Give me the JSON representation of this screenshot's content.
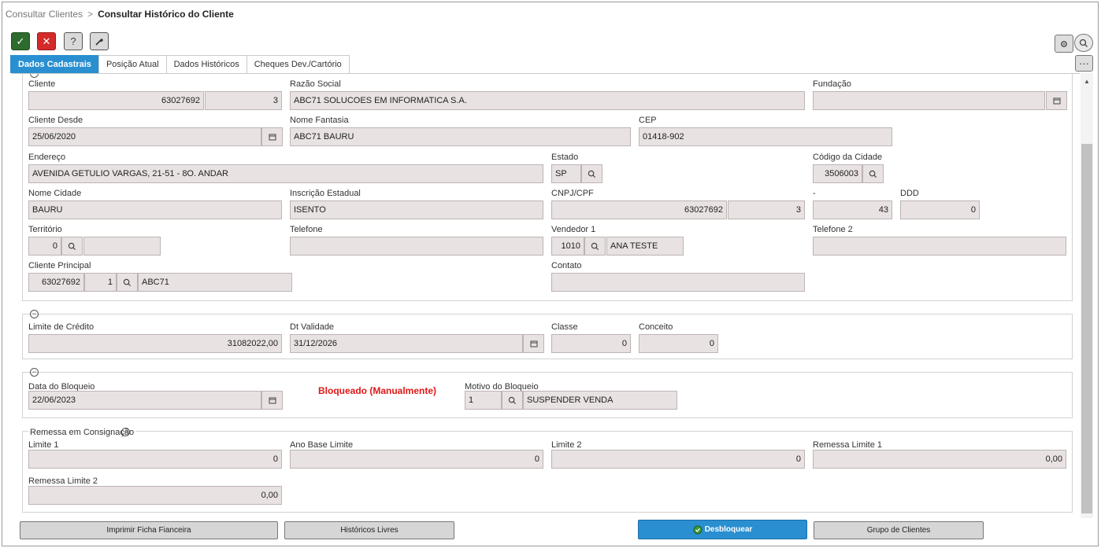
{
  "breadcrumb": {
    "parent": "Consultar Clientes",
    "separator": ">",
    "current": "Consultar Histórico do Cliente"
  },
  "toolbar": {
    "ok": "✓",
    "cancel": "✕",
    "help": "?",
    "tools_icon": "wrench-icon"
  },
  "tabs": [
    "Dados Cadastrais",
    "Posição Atual",
    "Dados Históricos",
    "Cheques Dev./Cartório"
  ],
  "colors": {
    "accent": "#2a8fd0",
    "danger": "#e01616",
    "field_bg": "#e9e2e2"
  },
  "cadastro": {
    "cliente_label": "Cliente",
    "cliente": "63027692",
    "cliente_seq": "3",
    "razao_label": "Razão Social",
    "razao": "ABC71 SOLUCOES EM INFORMATICA S.A.",
    "fundacao_label": "Fundação",
    "fundacao": "",
    "desde_label": "Cliente Desde",
    "desde": "25/06/2020",
    "fantasia_label": "Nome Fantasia",
    "fantasia": "ABC71 BAURU",
    "cep_label": "CEP",
    "cep": "01418-902",
    "endereco_label": "Endereço",
    "endereco": "AVENIDA GETULIO VARGAS, 21-51 - 8O. ANDAR",
    "estado_label": "Estado",
    "estado": "SP",
    "codcidade_label": "Código da Cidade",
    "codcidade": "3506003",
    "cidade_label": "Nome Cidade",
    "cidade": "BAURU",
    "ie_label": "Inscrição Estadual",
    "ie": "ISENTO",
    "cnpj_label": "CNPJ/CPF",
    "cnpj": "63027692",
    "cnpj_seq": "3",
    "dash_label": "-",
    "dash_val": "43",
    "ddd_label": "DDD",
    "ddd": "0",
    "territorio_label": "Território",
    "territorio": "0",
    "territorio_desc": "",
    "telefone_label": "Telefone",
    "telefone": "",
    "vendedor_label": "Vendedor 1",
    "vendedor": "1010",
    "vendedor_nome": "ANA TESTE",
    "telefone2_label": "Telefone 2",
    "telefone2": "",
    "principal_label": "Cliente Principal",
    "principal": "63027692",
    "principal_seq": "1",
    "principal_nome": "ABC71",
    "contato_label": "Contato",
    "contato": ""
  },
  "credito": {
    "limite_label": "Limite de Crédito",
    "limite": "31082022,00",
    "validade_label": "Dt Validade",
    "validade": "31/12/2026",
    "classe_label": "Classe",
    "classe": "0",
    "conceito_label": "Conceito",
    "conceito": "0"
  },
  "bloqueio": {
    "data_label": "Data do Bloqueio",
    "data": "22/06/2023",
    "status": "Bloqueado (Manualmente)",
    "motivo_label": "Motivo do Bloqueio",
    "motivo": "1",
    "motivo_desc": "SUSPENDER VENDA"
  },
  "remessa": {
    "title": "Remessa em Consignação",
    "limite1_label": "Limite 1",
    "limite1": "0",
    "anobase_label": "Ano Base Limite",
    "anobase": "0",
    "limite2_label": "Limite 2",
    "limite2": "0",
    "rlimite1_label": "Remessa Limite 1",
    "rlimite1": "0,00",
    "rlimite2_label": "Remessa Limite 2",
    "rlimite2": "0,00"
  },
  "buttons": {
    "imprimir": "Imprimir Ficha Fianceira",
    "historicos": "Históricos Livres",
    "desbloquear": "Desbloquear",
    "grupo": "Grupo de Clientes"
  }
}
